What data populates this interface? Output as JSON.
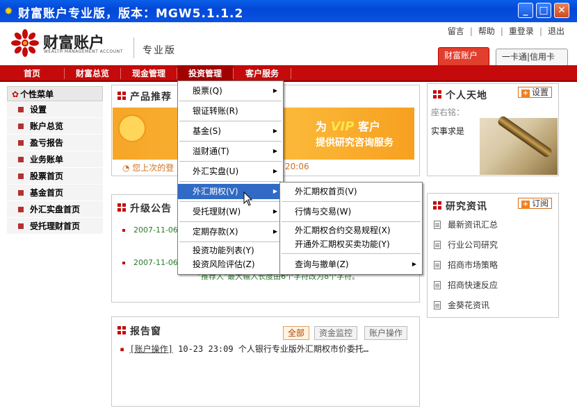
{
  "window": {
    "title": "财富账户专业版，版本：MGW5.1.1.2",
    "minimize": "_",
    "maximize": "□",
    "close": "✕"
  },
  "header": {
    "logo_text": "财富账户",
    "logo_sub": "WEALTH MANAGEMENT ACCOUNT",
    "edition": "专业版",
    "links": [
      "留言",
      "帮助",
      "重登录",
      "退出"
    ],
    "tabs": [
      "财富账户",
      "一卡通|信用卡"
    ]
  },
  "nav": {
    "items": [
      "首页",
      "财富总览",
      "现金管理",
      "投资管理",
      "客户服务"
    ]
  },
  "left_menu": {
    "title": "个性菜单",
    "items": [
      "设置",
      "账户总览",
      "盈亏报告",
      "业务账单",
      "股票首页",
      "基金首页",
      "外汇实盘首页",
      "受托理财首页"
    ]
  },
  "product_panel": {
    "title": "产品推荐",
    "banner_prefix": "为",
    "banner_vip": "VIP",
    "banner_suffix": "客户",
    "banner_line2": "提供研究咨询服务",
    "login_note": "您上次的登",
    "login_time": "20:06"
  },
  "announce_panel": {
    "title": "升级公告",
    "dates": [
      "2007-11-06",
      "2007-11-06"
    ],
    "note": "\"推荐人\"最大输入长度由6个字符改为8个字符。"
  },
  "report_panel": {
    "title": "报告窗",
    "tabs": [
      "全部",
      "资金监控",
      "账户操作"
    ],
    "line_tag": "[账户操作]",
    "line_text": " 10-23 23:09 个人银行专业版外汇期权市价委托…"
  },
  "personal_panel": {
    "title": "个人天地",
    "settings_btn": "设置",
    "motto_label": "座右铭：",
    "motto": "实事求是"
  },
  "research_panel": {
    "title": "研究资讯",
    "subscribe_btn": "订阅",
    "items": [
      "最新资讯汇总",
      "行业公司研究",
      "招商市场策略",
      "招商快速反应",
      "金葵花资讯"
    ]
  },
  "invest_menu": {
    "items": [
      {
        "label": "股票(Q)",
        "arrow": true
      },
      {
        "label": "银证转账(R)",
        "arrow": false
      },
      {
        "label": "基金(S)",
        "arrow": true
      },
      {
        "label": "溢财通(T)",
        "arrow": true
      },
      {
        "label": "外汇实盘(U)",
        "arrow": true
      },
      {
        "label": "外汇期权(V)",
        "arrow": true
      },
      {
        "label": "受托理财(W)",
        "arrow": true
      },
      {
        "label": "定期存款(X)",
        "arrow": true
      },
      {
        "label": "投资功能列表(Y)",
        "arrow": false
      },
      {
        "label": "投资风险评估(Z)",
        "arrow": false
      }
    ]
  },
  "fx_option_menu": {
    "items": [
      {
        "label": "外汇期权首页(V)",
        "arrow": false
      },
      {
        "label": "行情与交易(W)",
        "arrow": false
      },
      {
        "label": "外汇期权合约交易规程(X)",
        "arrow": false
      },
      {
        "label": "开通外汇期权买卖功能(Y)",
        "arrow": false
      },
      {
        "label": "查询与撤单(Z)",
        "arrow": true
      }
    ]
  },
  "colors": {
    "nav_red": "#c40a0a",
    "menu_highlight": "#316ac5",
    "title_blue": "#0348d8"
  }
}
